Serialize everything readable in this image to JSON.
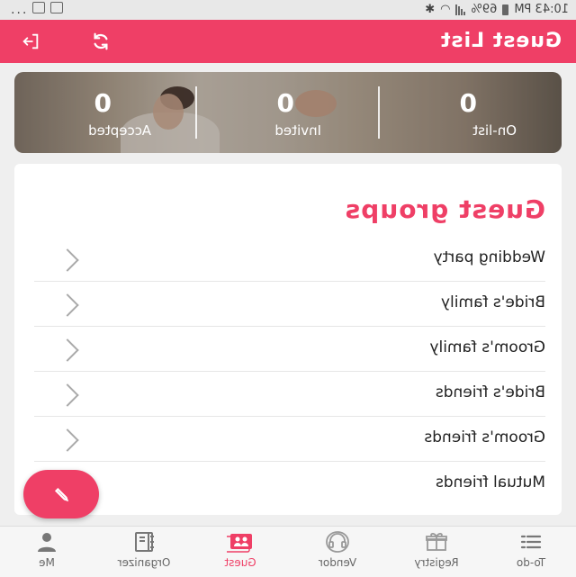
{
  "status_bar": {
    "time": "10:43 PM",
    "battery": "69%",
    "more": "..."
  },
  "app_bar": {
    "title": "Guest List"
  },
  "stats": [
    {
      "value": "0",
      "label": "On-list"
    },
    {
      "value": "0",
      "label": "Invited"
    },
    {
      "value": "0",
      "label": "Accepted"
    }
  ],
  "groups": {
    "heading": "Guest groups",
    "items": [
      "Wedding party",
      "Bride's family",
      "Groom's family",
      "Bride's friends",
      "Groom's friends",
      "Mutual friends"
    ]
  },
  "nav": [
    {
      "label": "To-do",
      "icon": "list-icon"
    },
    {
      "label": "Registry",
      "icon": "gift-icon"
    },
    {
      "label": "Vendor",
      "icon": "headset-icon"
    },
    {
      "label": "Guest",
      "icon": "guests-icon",
      "active": true
    },
    {
      "label": "Organizer",
      "icon": "organizer-icon"
    },
    {
      "label": "Me",
      "icon": "person-icon"
    }
  ],
  "colors": {
    "accent": "#ef3f66",
    "status_bar": "#e8e8e8",
    "background": "#efefef"
  }
}
